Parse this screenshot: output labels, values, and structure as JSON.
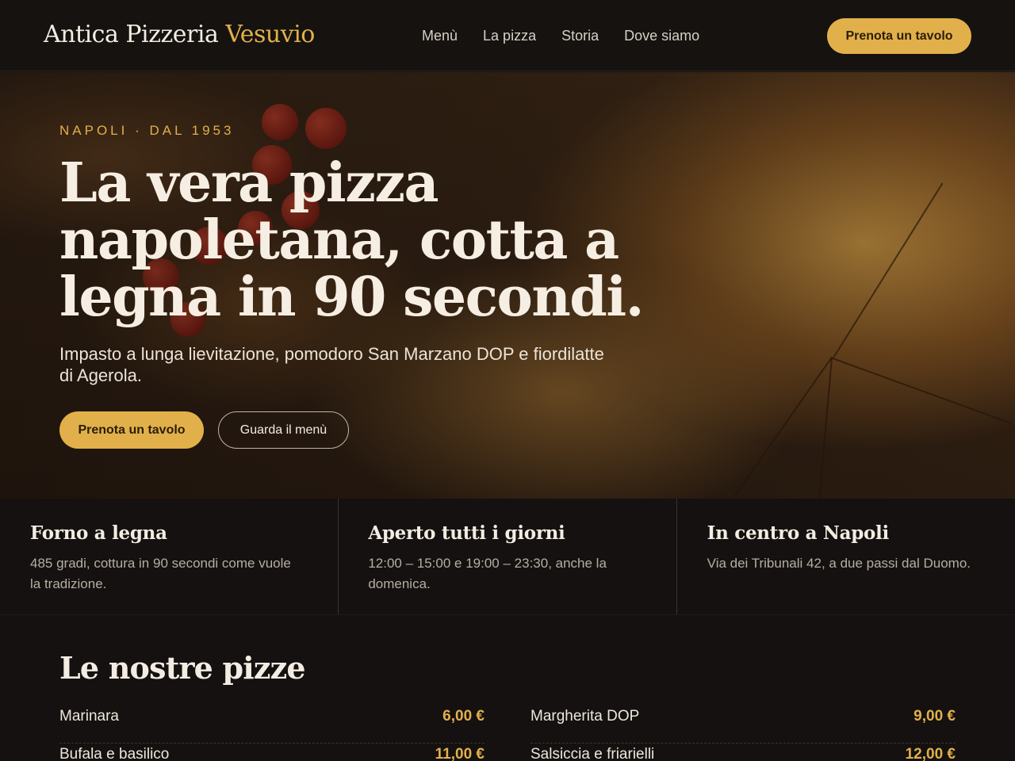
{
  "header": {
    "brand_main": "Antica Pizzeria",
    "brand_accent": "Vesuvio",
    "nav": [
      "Menù",
      "La pizza",
      "Storia",
      "Dove siamo"
    ],
    "cta": "Prenota un tavolo"
  },
  "hero": {
    "eyebrow": "NAPOLI · DAL 1953",
    "title": "La vera pizza napoletana, cotta a legna in 90 secondi.",
    "subtitle": "Impasto a lunga lievitazione, pomodoro San Marzano DOP e fiordilatte di Agerola.",
    "primary_button": "Prenota un tavolo",
    "secondary_button": "Guarda il menù"
  },
  "features": [
    {
      "title": "Forno a legna",
      "text": "485 gradi, cottura in 90 secondi come vuole la tradizione."
    },
    {
      "title": "Aperto tutti i giorni",
      "text": "12:00 – 15:00 e 19:00 – 23:30, anche la domenica."
    },
    {
      "title": "In centro a Napoli",
      "text": "Via dei Tribunali 42, a due passi dal Duomo."
    }
  ],
  "menu": {
    "title": "Le nostre pizze",
    "left": [
      {
        "name": "Marinara",
        "price": "6,00 €"
      },
      {
        "name": "Bufala e basilico",
        "price": "11,00 €"
      }
    ],
    "right": [
      {
        "name": "Margherita DOP",
        "price": "9,00 €"
      },
      {
        "name": "Salsiccia e friarielli",
        "price": "12,00 €"
      }
    ]
  },
  "colors": {
    "accent": "#e2b04a",
    "background": "#141110",
    "text": "#f3ece2"
  }
}
